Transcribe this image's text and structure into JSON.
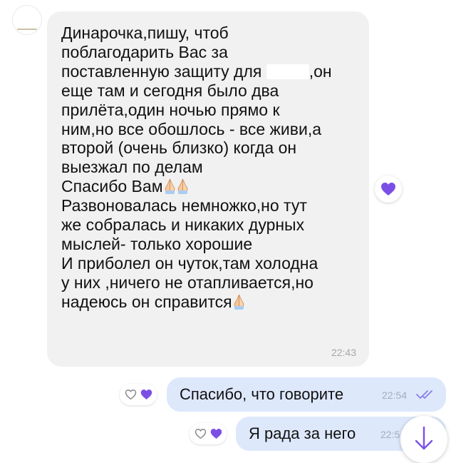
{
  "colors": {
    "incoming_bubble": "#f1f1f2",
    "outgoing_bubble": "#dde8fb",
    "accent_purple": "#7b4fe6",
    "timestamp_gray": "#a7a7ac"
  },
  "incoming_message": {
    "lines": [
      "Динарочка,пишу, чтоб",
      "поблагодарить Вас за",
      "поставленную защиту для",
      ",он",
      "еще там и сегодня было два",
      "прилёта,один ночью прямо к",
      "ним,но все обошлось - все живи,а",
      "второй (очень близко) когда он",
      "выезжал по делам",
      "Спасибо Вам",
      "Развоновалась немножко,но тут",
      "же собралась и никаких дурных",
      "мыслей- только хорошие",
      "И приболел он чуток,там холодна",
      "у них ,ничего не отапливается,но",
      "надеюсь он справится"
    ],
    "time": "22:43",
    "reaction_icon": "purple-heart-icon"
  },
  "outgoing_messages": [
    {
      "text": "Спасибо, что говорите",
      "time": "22:54",
      "status_icon": "double-check-icon",
      "reactions": [
        "heart-outline-icon",
        "purple-heart-icon"
      ]
    },
    {
      "text": "Я рада за него",
      "time": "22:5",
      "reactions": [
        "heart-outline-icon",
        "purple-heart-icon"
      ]
    }
  ],
  "scroll_button_icon": "arrow-down-icon"
}
